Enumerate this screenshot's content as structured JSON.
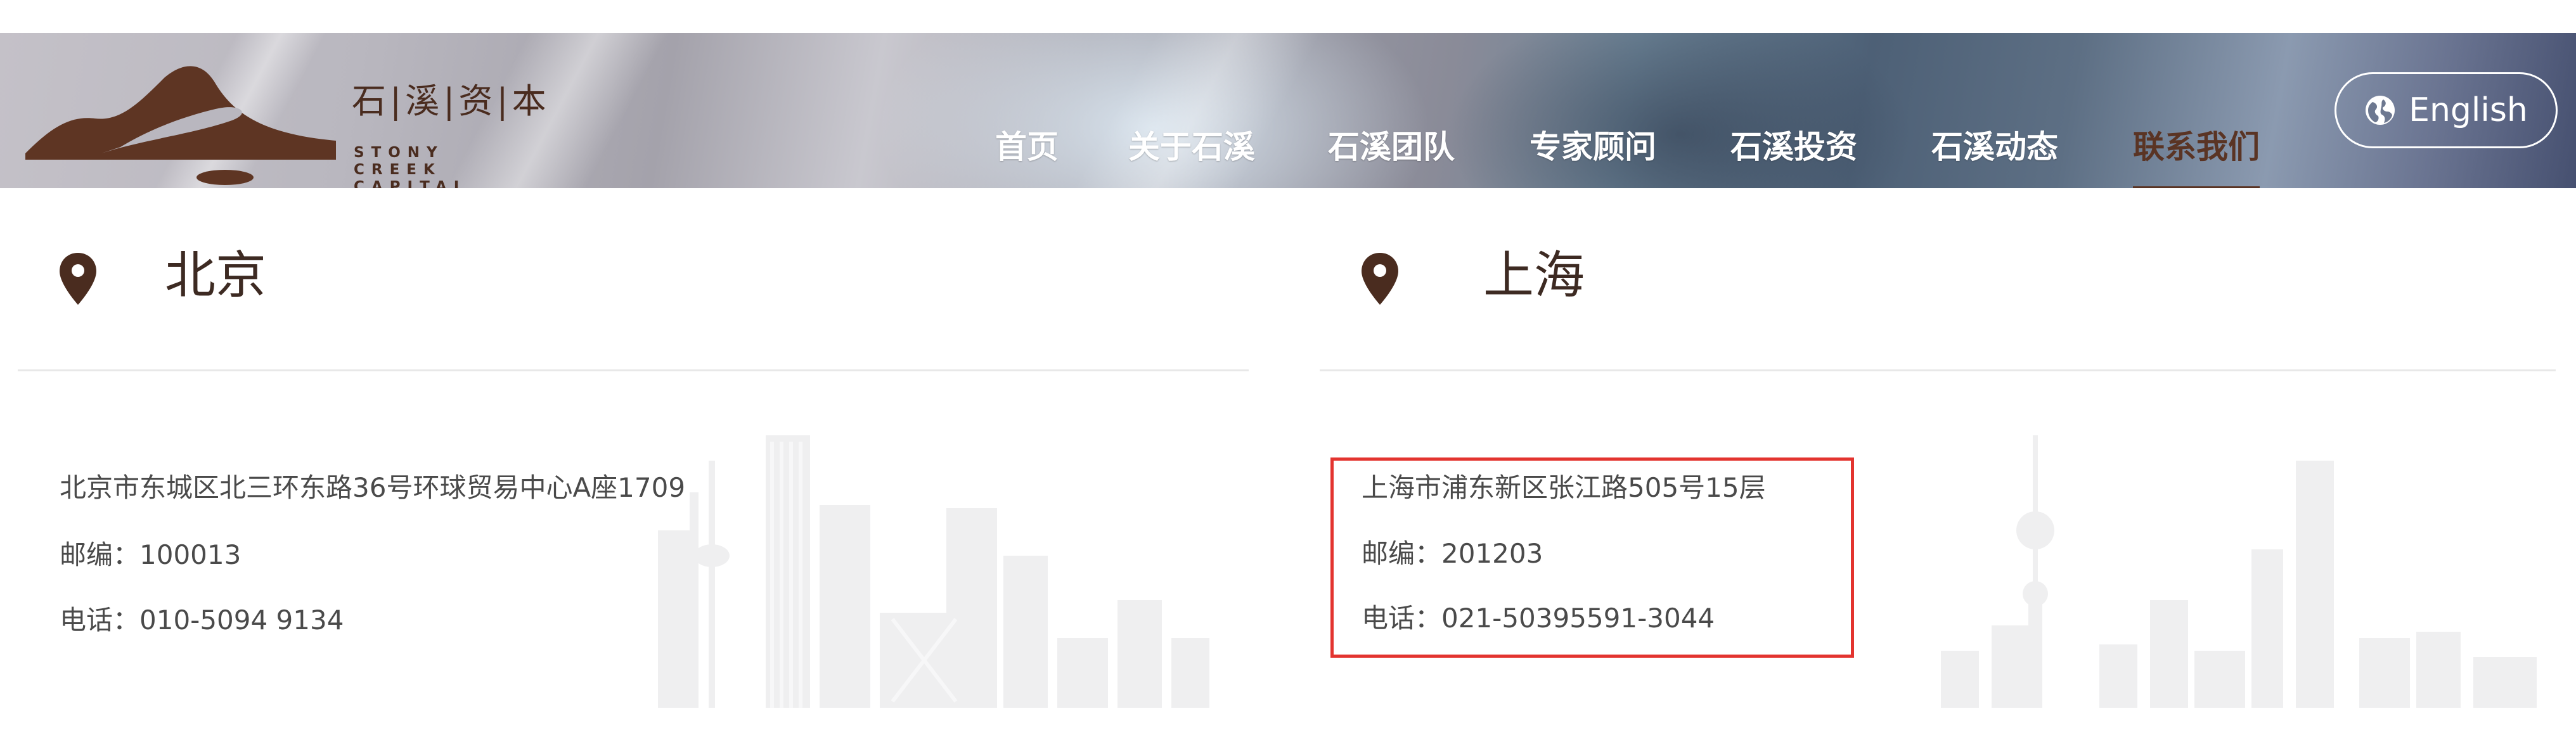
{
  "header": {
    "logo": {
      "cn": "石|溪|资|本",
      "en": "STONY CREEK CAPITAL"
    },
    "nav": [
      {
        "label": "首页",
        "active": false
      },
      {
        "label": "关于石溪",
        "active": false
      },
      {
        "label": "石溪团队",
        "active": false
      },
      {
        "label": "专家顾问",
        "active": false
      },
      {
        "label": "石溪投资",
        "active": false
      },
      {
        "label": "石溪动态",
        "active": false
      },
      {
        "label": "联系我们",
        "active": true
      }
    ],
    "language_button": {
      "label": "English",
      "icon": "globe-icon"
    }
  },
  "offices": [
    {
      "city": "北京",
      "icon": "location-pin-icon",
      "address": "北京市东城区北三环东路36号环球贸易中心A座1709",
      "postcode": "邮编：100013",
      "phone": "电话：010-5094 9134"
    },
    {
      "city": "上海",
      "icon": "location-pin-icon",
      "address": "上海市浦东新区张江路505号15层",
      "postcode": "邮编：201203",
      "phone": "电话：021-50395591-3044",
      "highlighted": true
    }
  ],
  "colors": {
    "brand_brown": "#5a3424",
    "nav_text": "#ffffff",
    "highlight_border": "#e3342f",
    "body_text": "#4a4a4a"
  }
}
